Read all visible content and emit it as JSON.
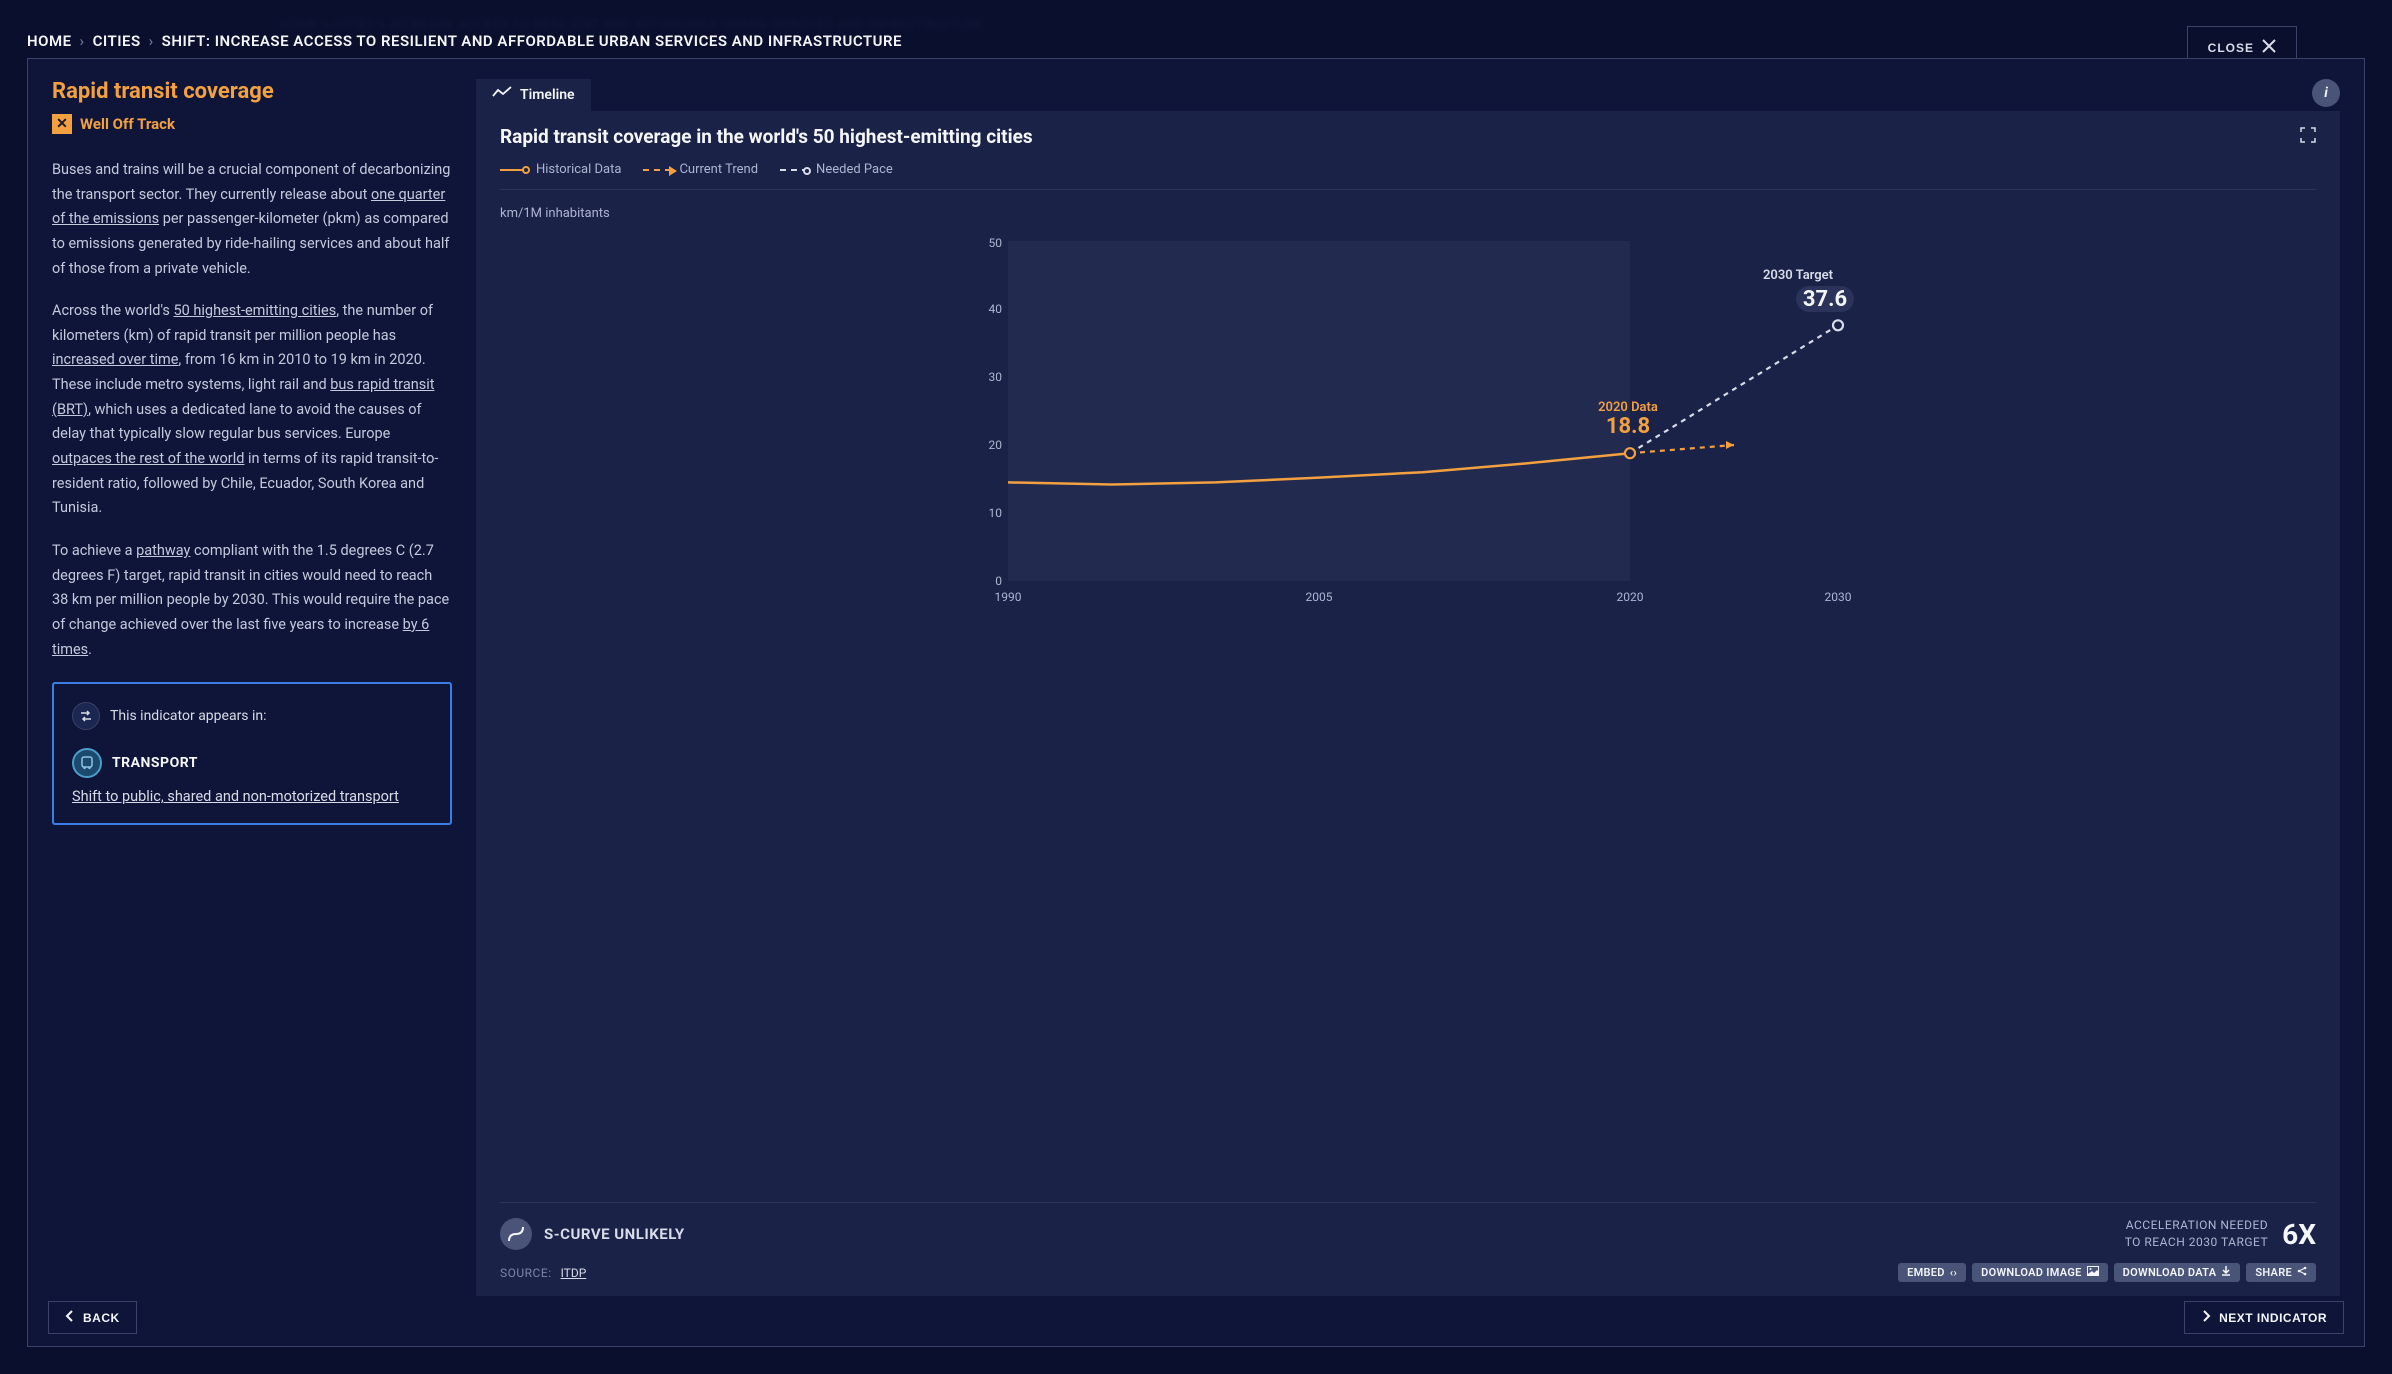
{
  "bg_breadcrumb": "HOME > CITIES > INCREASE ACCESS TO RESILIENT AND AFFORDABLE URBAN SERVICES AND INFRASTRUCTURE",
  "breadcrumb": {
    "home": "HOME",
    "parent": "CITIES",
    "current": "SHIFT: INCREASE ACCESS TO RESILIENT AND AFFORDABLE URBAN SERVICES AND INFRASTRUCTURE"
  },
  "close": "CLOSE",
  "left": {
    "title": "Rapid transit coverage",
    "status": "Well Off Track",
    "p1a": "Buses and trains will be a crucial component of decarbonizing the transport sector. They currently release about ",
    "p1_link1": "one quarter of the emissions",
    "p1b": " per passenger-kilometer (pkm) as compared to emissions generated by ride-hailing services and about half of those from a private vehicle.",
    "p2a": "Across the world's ",
    "p2_link1": "50 highest-emitting cities",
    "p2b": ", the number of kilometers (km) of rapid transit per million people has ",
    "p2_link2": "increased over time",
    "p2c": ", from 16 km in 2010 to 19 km in 2020. These include metro systems, light rail and ",
    "p2_link3": "bus rapid transit (BRT)",
    "p2d": ", which uses a dedicated lane to avoid the causes of delay that typically slow regular bus services. Europe ",
    "p2_link4": "outpaces the rest of the world",
    "p2e": " in terms of its rapid transit-to-resident ratio, followed by Chile, Ecuador, South Korea and Tunisia.",
    "p3a": "To achieve a ",
    "p3_link1": "pathway",
    "p3b": " compliant with the 1.5 degrees C (2.7 degrees F) target, rapid transit in cities would need to reach 38 km per million people by 2030. This would require the pace of change achieved over the last five years to increase ",
    "p3_link2": "by 6 times",
    "p3c": ".",
    "related": {
      "lead": "This indicator appears in:",
      "category": "TRANSPORT",
      "link": "Shift to public, shared and non-motorized transport"
    }
  },
  "tab": "Timeline",
  "chart": {
    "title": "Rapid transit coverage in the world's 50 highest-emitting cities",
    "legend": {
      "hist": "Historical Data",
      "trend": "Current Trend",
      "needed": "Needed Pace"
    },
    "ylabel": "km/1M inhabitants",
    "data_label": "2020 Data",
    "data_value": "18.8",
    "target_label": "2030 Target",
    "target_value": "37.6",
    "scurve": "S-CURVE UNLIKELY",
    "accel1": "ACCELERATION NEEDED",
    "accel2": "TO REACH 2030 TARGET",
    "accel_num": "6X",
    "source_label": "SOURCE:",
    "source_name": "ITDP",
    "btns": {
      "embed": "EMBED",
      "dl_img": "DOWNLOAD IMAGE",
      "dl_data": "DOWNLOAD DATA",
      "share": "SHARE"
    }
  },
  "nav": {
    "back": "BACK",
    "next": "NEXT INDICATOR"
  },
  "chart_data": {
    "type": "line",
    "title": "Rapid transit coverage in the world's 50 highest-emitting cities",
    "ylabel": "km/1M inhabitants",
    "xlabel": "",
    "ylim": [
      0,
      50
    ],
    "xlim": [
      1990,
      2030
    ],
    "x_ticks": [
      1990,
      2005,
      2020,
      2030
    ],
    "y_ticks": [
      0,
      10,
      20,
      30,
      40,
      50
    ],
    "series": [
      {
        "name": "Historical Data",
        "style": "solid",
        "color": "#f2a040",
        "x": [
          1990,
          1995,
          2000,
          2005,
          2010,
          2015,
          2020
        ],
        "values": [
          14.5,
          14.2,
          14.5,
          15.2,
          16.0,
          17.3,
          18.8
        ]
      },
      {
        "name": "Current Trend",
        "style": "dashed-arrow",
        "color": "#f2a040",
        "x": [
          2020,
          2025
        ],
        "values": [
          18.8,
          20.0
        ]
      },
      {
        "name": "Needed Pace",
        "style": "dashed",
        "color": "#d8dce8",
        "x": [
          2020,
          2030
        ],
        "values": [
          18.8,
          37.6
        ]
      }
    ],
    "annotations": [
      {
        "label": "2020 Data",
        "value": 18.8,
        "x": 2020
      },
      {
        "label": "2030 Target",
        "value": 37.6,
        "x": 2030
      }
    ]
  }
}
